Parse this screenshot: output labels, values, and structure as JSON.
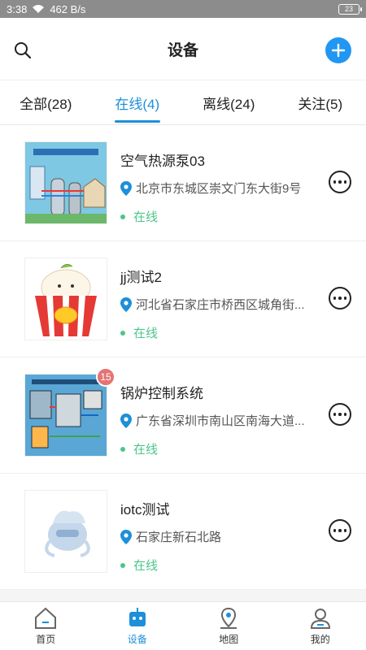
{
  "statusbar": {
    "time": "3:38",
    "speed": "462 B/s",
    "battery": "23"
  },
  "header": {
    "title": "设备",
    "search_icon": "search-icon",
    "add_icon": "plus-icon",
    "accent": "#2196f3"
  },
  "tabs": [
    {
      "label": "全部(28)"
    },
    {
      "label": "在线(4)",
      "active": true
    },
    {
      "label": "离线(24)"
    },
    {
      "label": "关注(5)"
    }
  ],
  "devices": [
    {
      "name": "空气热源泵03",
      "address": "北京市东城区崇文门东大街9号",
      "status": "在线"
    },
    {
      "name": "jj测试2",
      "address": "河北省石家庄市桥西区城角街...",
      "status": "在线"
    },
    {
      "name": "锅炉控制系统",
      "address": "广东省深圳市南山区南海大道...",
      "status": "在线",
      "badge": "15"
    },
    {
      "name": "iotc测试",
      "address": "石家庄新石北路",
      "status": "在线"
    }
  ],
  "bottom_nav": [
    {
      "label": "首页"
    },
    {
      "label": "设备",
      "active": true
    },
    {
      "label": "地图"
    },
    {
      "label": "我的"
    }
  ],
  "colors": {
    "online": "#4cc58a",
    "tab_active": "#1e8fd8",
    "badge": "#e57373"
  }
}
